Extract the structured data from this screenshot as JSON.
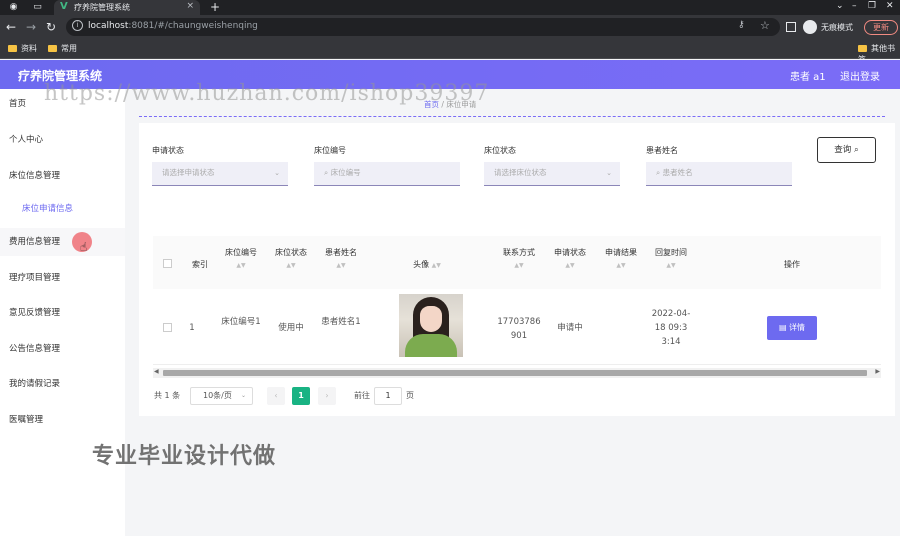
{
  "browser": {
    "tab_title": "疗养院管理系统",
    "tab_close": "×",
    "new_tab": "+",
    "url_host": "localhost",
    "url_rest": ":8081/#/chaungweishenqing",
    "incognito_label": "无痕模式",
    "update_label": "更新",
    "bookmarks": [
      "资料",
      "常用",
      "其他书签"
    ]
  },
  "app": {
    "title": "疗养院管理系统",
    "user": "患者 a1",
    "logout": "退出登录",
    "accent_color": "#6d6af0"
  },
  "sidebar": {
    "items": [
      {
        "label": "首页"
      },
      {
        "label": "个人中心"
      },
      {
        "label": "床位信息管理"
      },
      {
        "label": "床位申请信息"
      },
      {
        "label": "费用信息管理"
      },
      {
        "label": "理疗项目管理"
      },
      {
        "label": "意见反馈管理"
      },
      {
        "label": "公告信息管理"
      },
      {
        "label": "我的请假记录"
      },
      {
        "label": "医嘱管理"
      }
    ]
  },
  "breadcrumb": {
    "home": "首页",
    "sep": "/",
    "current": "床位申请"
  },
  "filters": {
    "status_label": "申请状态",
    "status_placeholder": "请选择申请状态",
    "bed_label": "床位编号",
    "bed_placeholder": "床位编号",
    "bed_status_label": "床位状态",
    "bed_status_placeholder": "请选择床位状态",
    "patient_label": "患者姓名",
    "patient_placeholder": "患者姓名",
    "query_label": "查询"
  },
  "table": {
    "headers": {
      "index": "索引",
      "bed_no": "床位编号",
      "bed_status": "床位状态",
      "patient": "患者姓名",
      "avatar": "头像",
      "phone": "联系方式",
      "apply_status": "申请状态",
      "apply_result": "申请结果",
      "reply_time": "回复时间",
      "action": "操作"
    },
    "rows": [
      {
        "index": "1",
        "bed_no": "床位编号1",
        "bed_status": "使用中",
        "patient": "患者姓名1",
        "phone": "17703786901",
        "apply_status": "申请中",
        "apply_result": "",
        "reply_time": "2022-04-18 09:33:14",
        "detail_label": "详情"
      }
    ]
  },
  "pagination": {
    "total": "共 1 条",
    "page_size": "10条/页",
    "current_page": "1",
    "goto_prefix": "前往",
    "goto_value": "1",
    "goto_suffix": "页",
    "active_color": "#19b383"
  },
  "overlay": {
    "watermark": "https://www.huzhan.com/ishop39397",
    "promo": "专业毕业设计代做"
  }
}
